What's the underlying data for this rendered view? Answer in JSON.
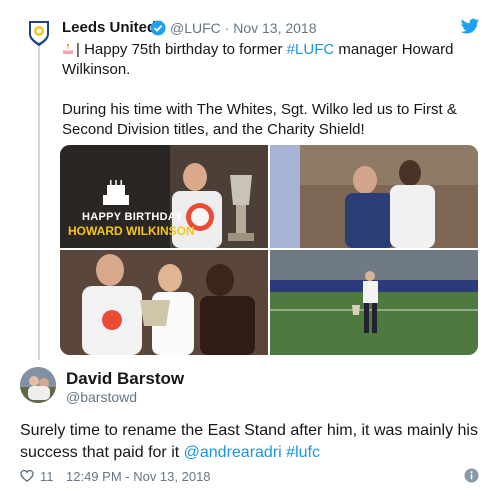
{
  "quoted_tweet": {
    "author_name": "Leeds United",
    "handle_date": "@LUFC · Nov 13, 2018",
    "text_part1": "| Happy 75th birthday to former ",
    "hashtag": "#LUFC",
    "text_part2": " manager Howard Wilkinson.\n\nDuring his time with The Whites, Sgt. Wilko led us to First & Second Division titles, and the Charity Shield!",
    "media": {
      "banner_line1": "HAPPY BIRTHDAY",
      "banner_line2": "HOWARD WILKINSON"
    }
  },
  "reply": {
    "author_name": "David Barstow",
    "handle": "@barstowd",
    "text": "Surely time to rename the East Stand after him, it was mainly his success that paid for it ",
    "mention": "@andrearadri",
    "hashtag": "#lufc",
    "likes": "11",
    "timestamp": "12:49 PM - Nov 13, 2018"
  },
  "colors": {
    "link": "#1b95e0",
    "secondary_text": "#657786",
    "thread_line": "#ccd6dd"
  },
  "icons": [
    "leeds-crest-icon",
    "verified-badge-icon",
    "twitter-bird-icon",
    "birthday-cake-icon",
    "heart-icon",
    "info-icon"
  ]
}
